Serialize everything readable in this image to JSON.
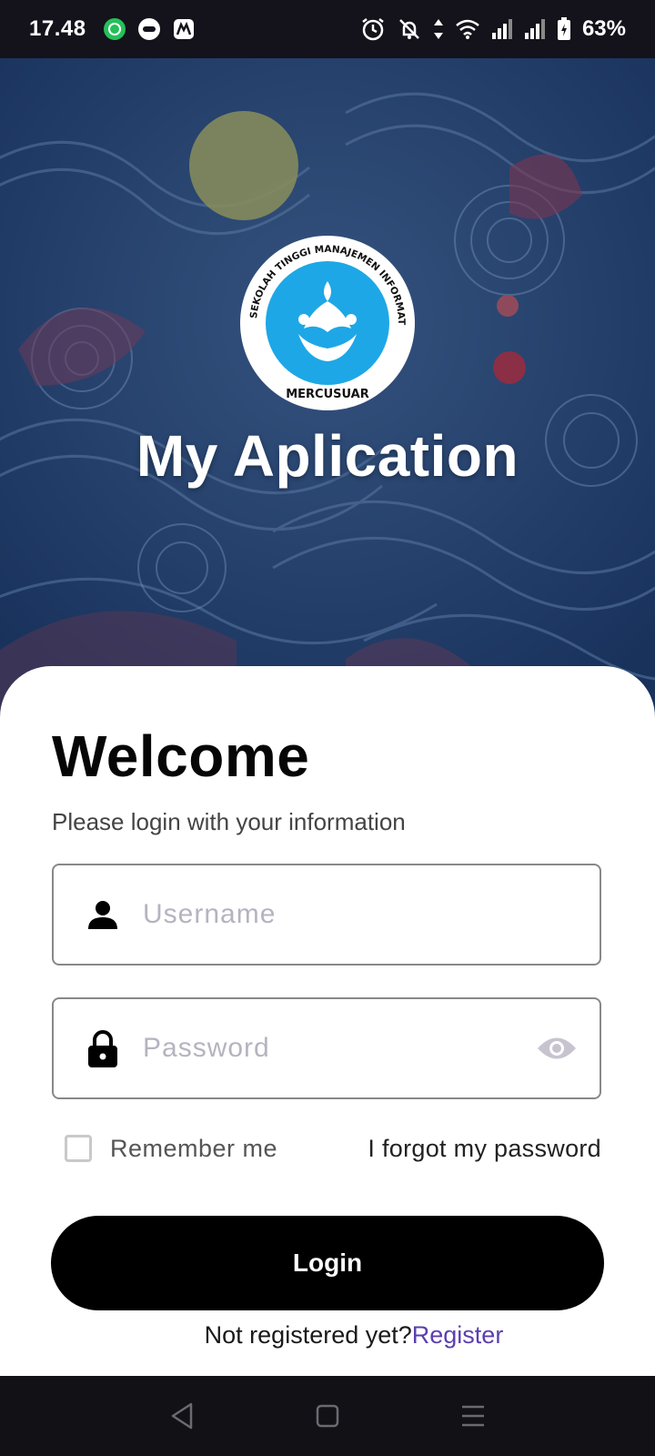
{
  "status_bar": {
    "time": "17.48",
    "battery_percent": "63%",
    "left_icons": [
      "whatsapp-icon",
      "chat-icon",
      "gallery-icon"
    ],
    "right_icons": [
      "alarm-icon",
      "bell-off-icon",
      "data-arrows-icon",
      "wifi-icon",
      "signal-icon",
      "signal-icon",
      "battery-charging-icon"
    ]
  },
  "hero": {
    "logo": {
      "ring_text": "SEKOLAH TINGGI MANAJEMEN INFORMATIKA DAN KOMPUTER",
      "bottom_text": "MERCUSUAR",
      "ring_color": "#ffffff",
      "inner_color": "#1ea7e6"
    },
    "app_title": "My Aplication"
  },
  "login": {
    "title": "Welcome",
    "subtitle": "Please login with your information",
    "username": {
      "value": "",
      "placeholder": "Username",
      "icon": "person-icon"
    },
    "password": {
      "value": "",
      "placeholder": "Password",
      "icon": "lock-icon",
      "toggle_icon": "eye-icon"
    },
    "remember_me": {
      "label": "Remember me",
      "checked": false
    },
    "forgot_link": "I forgot my password",
    "login_button": "Login",
    "register_prompt": "Not registered yet?",
    "register_link": "Register",
    "accent_color": "#5b3fb0"
  },
  "nav_bar": {
    "buttons": [
      "back-icon",
      "home-icon",
      "menu-icon"
    ]
  }
}
